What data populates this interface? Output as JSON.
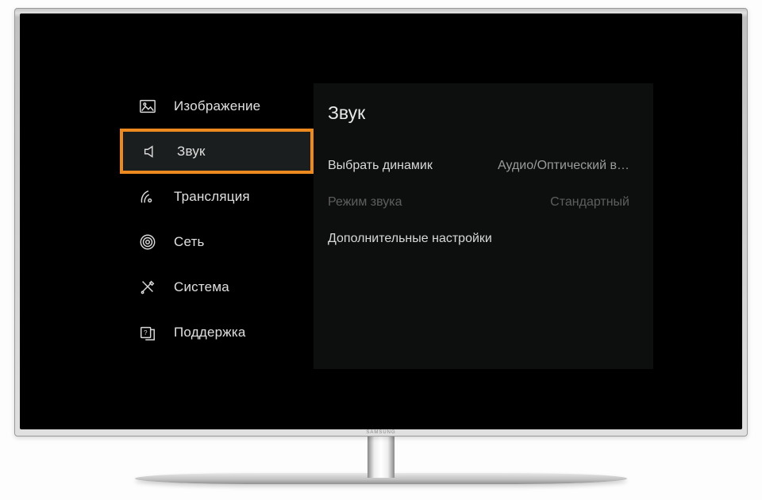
{
  "sidebar": {
    "items": [
      {
        "label": "Изображение"
      },
      {
        "label": "Звук"
      },
      {
        "label": "Трансляция"
      },
      {
        "label": "Сеть"
      },
      {
        "label": "Система"
      },
      {
        "label": "Поддержка"
      }
    ]
  },
  "content": {
    "title": "Звук",
    "settings": [
      {
        "label": "Выбрать динамик",
        "value": "Аудио/Оптический в…",
        "disabled": false
      },
      {
        "label": "Режим звука",
        "value": "Стандартный",
        "disabled": true
      },
      {
        "label": "Дополнительные настройки",
        "value": "",
        "disabled": false
      }
    ]
  },
  "colors": {
    "highlight": "#ed8a1f"
  }
}
